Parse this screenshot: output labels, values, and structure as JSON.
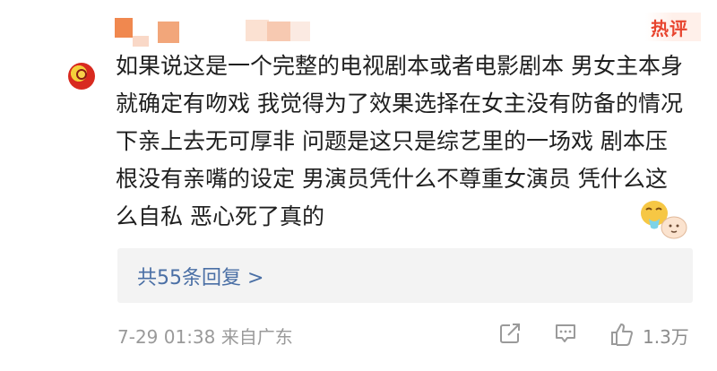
{
  "badge": {
    "label": "热评"
  },
  "comment": {
    "text": "如果说这是一个完整的电视剧本或者电影剧本 男女主本身就确定有吻戏 我觉得为了效果选择在女主没有防备的情况下亲上去无可厚非 问题是这只是综艺里的一场戏 剧本压根没有亲嘴的设定 男演员凭什么不尊重女演员 凭什么这么自私 恶心死了真的",
    "sticker_icon": "vomit-emoji-sticker"
  },
  "replies": {
    "label": "共55条回复 >"
  },
  "footer": {
    "time_location": "7-29 01:38  来自广东",
    "like_count": "1.3万",
    "icons": [
      "share-icon",
      "comment-icon",
      "like-icon"
    ]
  },
  "colors": {
    "badge": "#e8452f",
    "reply_link": "#4a6fa5",
    "meta_text": "#9a9a9a",
    "reply_bg": "#f3f3f3"
  }
}
